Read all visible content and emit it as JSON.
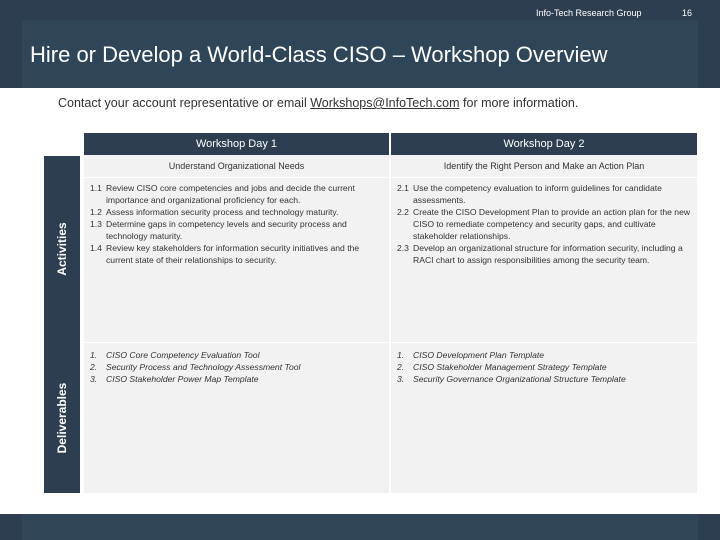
{
  "header": {
    "title": "Hire or Develop a World-Class CISO – Workshop Overview"
  },
  "contact": {
    "prefix": "Contact your account representative or email ",
    "email": "Workshops@InfoTech.com",
    "suffix": " for more information."
  },
  "sidebar": {
    "activities_label": "Activities",
    "deliverables_label": "Deliverables"
  },
  "days": [
    {
      "title": "Workshop Day 1",
      "subtitle": "Understand Organizational Needs",
      "activities": [
        {
          "num": "1.1",
          "text": "Review CISO core competencies and jobs and decide the current importance and organizational proficiency for each."
        },
        {
          "num": "1.2",
          "text": "Assess information security process and technology maturity."
        },
        {
          "num": "1.3",
          "text": "Determine gaps in competency levels and security process and technology maturity."
        },
        {
          "num": "1.4",
          "text": "Review key stakeholders for information security initiatives and the current state of their relationships to security."
        }
      ],
      "deliverables": [
        {
          "num": "1.",
          "text": "CISO Core Competency Evaluation Tool"
        },
        {
          "num": "2.",
          "text": "Security Process and Technology Assessment Tool"
        },
        {
          "num": "3.",
          "text": "CISO Stakeholder Power Map Template"
        }
      ]
    },
    {
      "title": "Workshop Day 2",
      "subtitle": "Identify the Right Person and Make an Action Plan",
      "activities": [
        {
          "num": "2.1",
          "text": "Use the competency evaluation to inform guidelines for candidate assessments."
        },
        {
          "num": "2.2",
          "text": "Create the CISO Development Plan to provide an action plan for the new CISO to remediate competency and security gaps, and cultivate stakeholder relationships."
        },
        {
          "num": "2.3",
          "text": "Develop an organizational structure for information security, including a RACI chart to assign responsibilities among the security team."
        }
      ],
      "deliverables": [
        {
          "num": "1.",
          "text": "CISO Development Plan Template"
        },
        {
          "num": "2.",
          "text": "CISO Stakeholder Management Strategy Template"
        },
        {
          "num": "3.",
          "text": "Security Governance Organizational Structure Template"
        }
      ]
    }
  ],
  "footer": {
    "brand": "Info-Tech Research Group",
    "page": "16"
  }
}
